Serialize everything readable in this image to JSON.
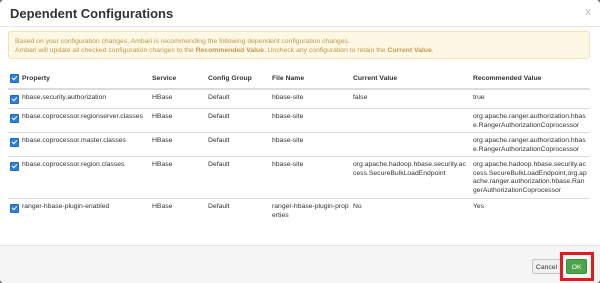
{
  "dialog": {
    "title": "Dependent Configurations",
    "close_glyph": "x"
  },
  "alert": {
    "line1": "Based on your configuration changes, Ambari is recommending the following dependent configuration changes.",
    "line2_a": "Ambari will update all checked configuration changes to the ",
    "line2_b": "Recommended Value",
    "line2_c": ". Uncheck any configuration to retain the ",
    "line2_d": "Current Value",
    "line2_e": "."
  },
  "table": {
    "headers": {
      "property": "Property",
      "service": "Service",
      "config_group": "Config Group",
      "file_name": "File Name",
      "current_value": "Current Value",
      "recommended_value": "Recommended Value"
    },
    "rows": [
      {
        "checked": true,
        "property": "hbase.security.authorization",
        "service": "HBase",
        "config_group": "Default",
        "file_name": "hbase-site",
        "current_value": "false",
        "recommended_value": "true"
      },
      {
        "checked": true,
        "property": "hbase.coprocessor.regionserver.classes",
        "service": "HBase",
        "config_group": "Default",
        "file_name": "hbase-site",
        "current_value": "",
        "recommended_value": "org.apache.ranger.authorization.hbase.RangerAuthorizationCoprocessor"
      },
      {
        "checked": true,
        "property": "hbase.coprocessor.master.classes",
        "service": "HBase",
        "config_group": "Default",
        "file_name": "hbase-site",
        "current_value": "",
        "recommended_value": "org.apache.ranger.authorization.hbase.RangerAuthorizationCoprocessor"
      },
      {
        "checked": true,
        "property": "hbase.coprocessor.region.classes",
        "service": "HBase",
        "config_group": "Default",
        "file_name": "hbase-site",
        "current_value": "org.apache.hadoop.hbase.security.access.SecureBulkLoadEndpoint",
        "recommended_value": "org.apache.hadoop.hbase.security.access.SecureBulkLoadEndpoint,org.apache.ranger.authorization.hbase.RangerAuthorizationCoprocessor"
      },
      {
        "checked": true,
        "property": "ranger-hbase-plugin-enabled",
        "service": "HBase",
        "config_group": "Default",
        "file_name": "ranger-hbase-plugin-properties",
        "current_value": "No",
        "recommended_value": "Yes"
      }
    ]
  },
  "footer": {
    "cancel_label": "Cancel",
    "ok_label": "OK"
  },
  "colors": {
    "alert_bg": "#fcf8e3",
    "alert_text": "#c09853",
    "checkbox": "#2f7fd8",
    "ok_button": "#4aa54a",
    "highlight_box": "#e11b1b"
  }
}
